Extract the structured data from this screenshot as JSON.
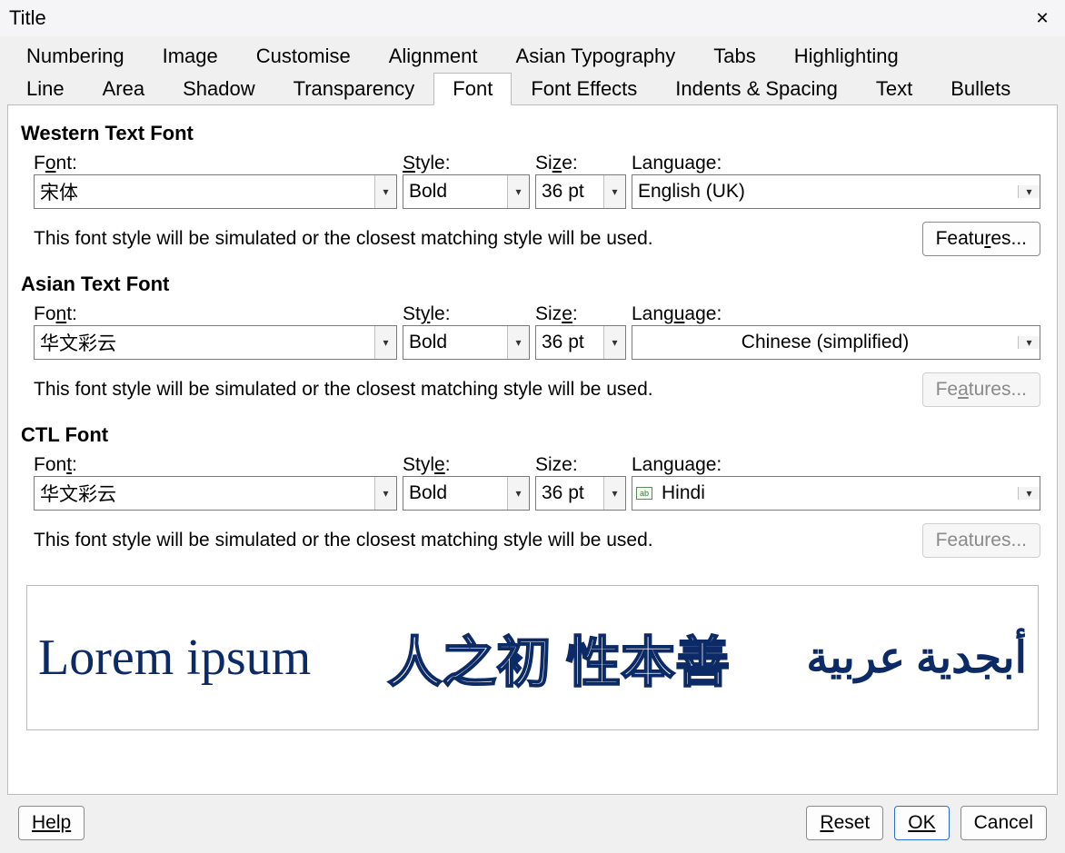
{
  "window": {
    "title": "Title"
  },
  "tabs_row1": [
    "Numbering",
    "Image",
    "Customise",
    "Alignment",
    "Asian Typography",
    "Tabs",
    "Highlighting"
  ],
  "tabs_row2": [
    "Line",
    "Area",
    "Shadow",
    "Transparency",
    "Font",
    "Font Effects",
    "Indents & Spacing",
    "Text",
    "Bullets"
  ],
  "active_tab": "Font",
  "labels": {
    "font": "Font:",
    "style": "Style:",
    "size": "Size:",
    "language": "Language:",
    "features": "Features...",
    "help": "Help",
    "reset": "Reset",
    "ok": "OK",
    "cancel": "Cancel"
  },
  "sections": {
    "western": {
      "title": "Western Text Font",
      "font": "宋体",
      "style": "Bold",
      "size": "36 pt",
      "language": "English (UK)",
      "hint": "This font style will be simulated or the closest matching style will be used.",
      "features_enabled": true
    },
    "asian": {
      "title": "Asian Text Font",
      "font": "华文彩云",
      "style": "Bold",
      "size": "36 pt",
      "language": "Chinese (simplified)",
      "hint": "This font style will be simulated or the closest matching style will be used.",
      "features_enabled": false
    },
    "ctl": {
      "title": "CTL Font",
      "font": "华文彩云",
      "style": "Bold",
      "size": "36 pt",
      "language": "Hindi",
      "language_icon": "ab",
      "hint": "This font style will be simulated or the closest matching style will be used.",
      "features_enabled": false
    }
  },
  "preview": {
    "western_sample": "Lorem ipsum",
    "cjk_sample": "人之初 性本善",
    "arabic_sample": "أبجدية عربية"
  }
}
